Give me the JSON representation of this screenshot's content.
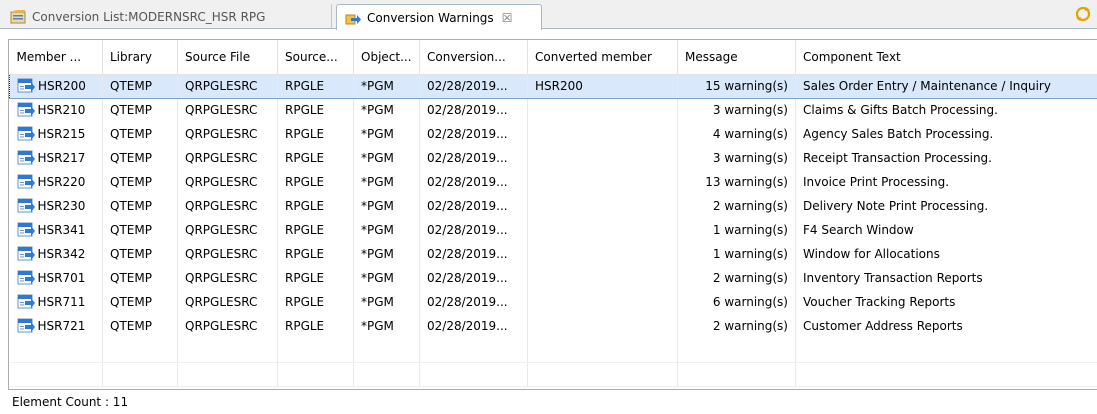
{
  "tabs": [
    {
      "label": "Conversion List:MODERNSRC_HSR RPG"
    },
    {
      "label": "Conversion Warnings",
      "close": "☒"
    }
  ],
  "columns": [
    "Member ...",
    "Library",
    "Source File",
    "Source...",
    "Object...",
    "Conversion...",
    "Converted member",
    "Message",
    "Component Text"
  ],
  "rows": [
    {
      "member": "HSR200",
      "library": "QTEMP",
      "source_file": "QRPGLESRC",
      "source_type": "RPGLE",
      "object_type": "*PGM",
      "conversion": "02/28/2019...",
      "converted": "HSR200",
      "message": "15 warning(s)",
      "text": "Sales Order Entry / Maintenance / Inquiry"
    },
    {
      "member": "HSR210",
      "library": "QTEMP",
      "source_file": "QRPGLESRC",
      "source_type": "RPGLE",
      "object_type": "*PGM",
      "conversion": "02/28/2019...",
      "converted": "",
      "message": "3 warning(s)",
      "text": "Claims & Gifts Batch Processing."
    },
    {
      "member": "HSR215",
      "library": "QTEMP",
      "source_file": "QRPGLESRC",
      "source_type": "RPGLE",
      "object_type": "*PGM",
      "conversion": "02/28/2019...",
      "converted": "",
      "message": "4 warning(s)",
      "text": "Agency Sales Batch Processing."
    },
    {
      "member": "HSR217",
      "library": "QTEMP",
      "source_file": "QRPGLESRC",
      "source_type": "RPGLE",
      "object_type": "*PGM",
      "conversion": "02/28/2019...",
      "converted": "",
      "message": "3 warning(s)",
      "text": "Receipt Transaction Processing."
    },
    {
      "member": "HSR220",
      "library": "QTEMP",
      "source_file": "QRPGLESRC",
      "source_type": "RPGLE",
      "object_type": "*PGM",
      "conversion": "02/28/2019...",
      "converted": "",
      "message": "13 warning(s)",
      "text": "Invoice Print Processing."
    },
    {
      "member": "HSR230",
      "library": "QTEMP",
      "source_file": "QRPGLESRC",
      "source_type": "RPGLE",
      "object_type": "*PGM",
      "conversion": "02/28/2019...",
      "converted": "",
      "message": "2 warning(s)",
      "text": "Delivery Note Print Processing."
    },
    {
      "member": "HSR341",
      "library": "QTEMP",
      "source_file": "QRPGLESRC",
      "source_type": "RPGLE",
      "object_type": "*PGM",
      "conversion": "02/28/2019...",
      "converted": "",
      "message": "1 warning(s)",
      "text": "F4 Search Window"
    },
    {
      "member": "HSR342",
      "library": "QTEMP",
      "source_file": "QRPGLESRC",
      "source_type": "RPGLE",
      "object_type": "*PGM",
      "conversion": "02/28/2019...",
      "converted": "",
      "message": "1 warning(s)",
      "text": "Window for Allocations"
    },
    {
      "member": "HSR701",
      "library": "QTEMP",
      "source_file": "QRPGLESRC",
      "source_type": "RPGLE",
      "object_type": "*PGM",
      "conversion": "02/28/2019...",
      "converted": "",
      "message": "2 warning(s)",
      "text": "Inventory Transaction Reports"
    },
    {
      "member": "HSR711",
      "library": "QTEMP",
      "source_file": "QRPGLESRC",
      "source_type": "RPGLE",
      "object_type": "*PGM",
      "conversion": "02/28/2019...",
      "converted": "",
      "message": "6 warning(s)",
      "text": "Voucher Tracking Reports"
    },
    {
      "member": "HSR721",
      "library": "QTEMP",
      "source_file": "QRPGLESRC",
      "source_type": "RPGLE",
      "object_type": "*PGM",
      "conversion": "02/28/2019...",
      "converted": "",
      "message": "2 warning(s)",
      "text": "Customer Address Reports"
    }
  ],
  "status": {
    "element_count": "Element Count : 11"
  },
  "icons": {
    "tab1": "conversion-list-icon",
    "tab2": "conversion-warnings-icon",
    "row": "source-member-icon",
    "toolbar": "sync-icon"
  },
  "colors": {
    "selection": "#d9e8fb",
    "selection_border": "#7da2ce",
    "icon_blue": "#2b7bd6"
  }
}
